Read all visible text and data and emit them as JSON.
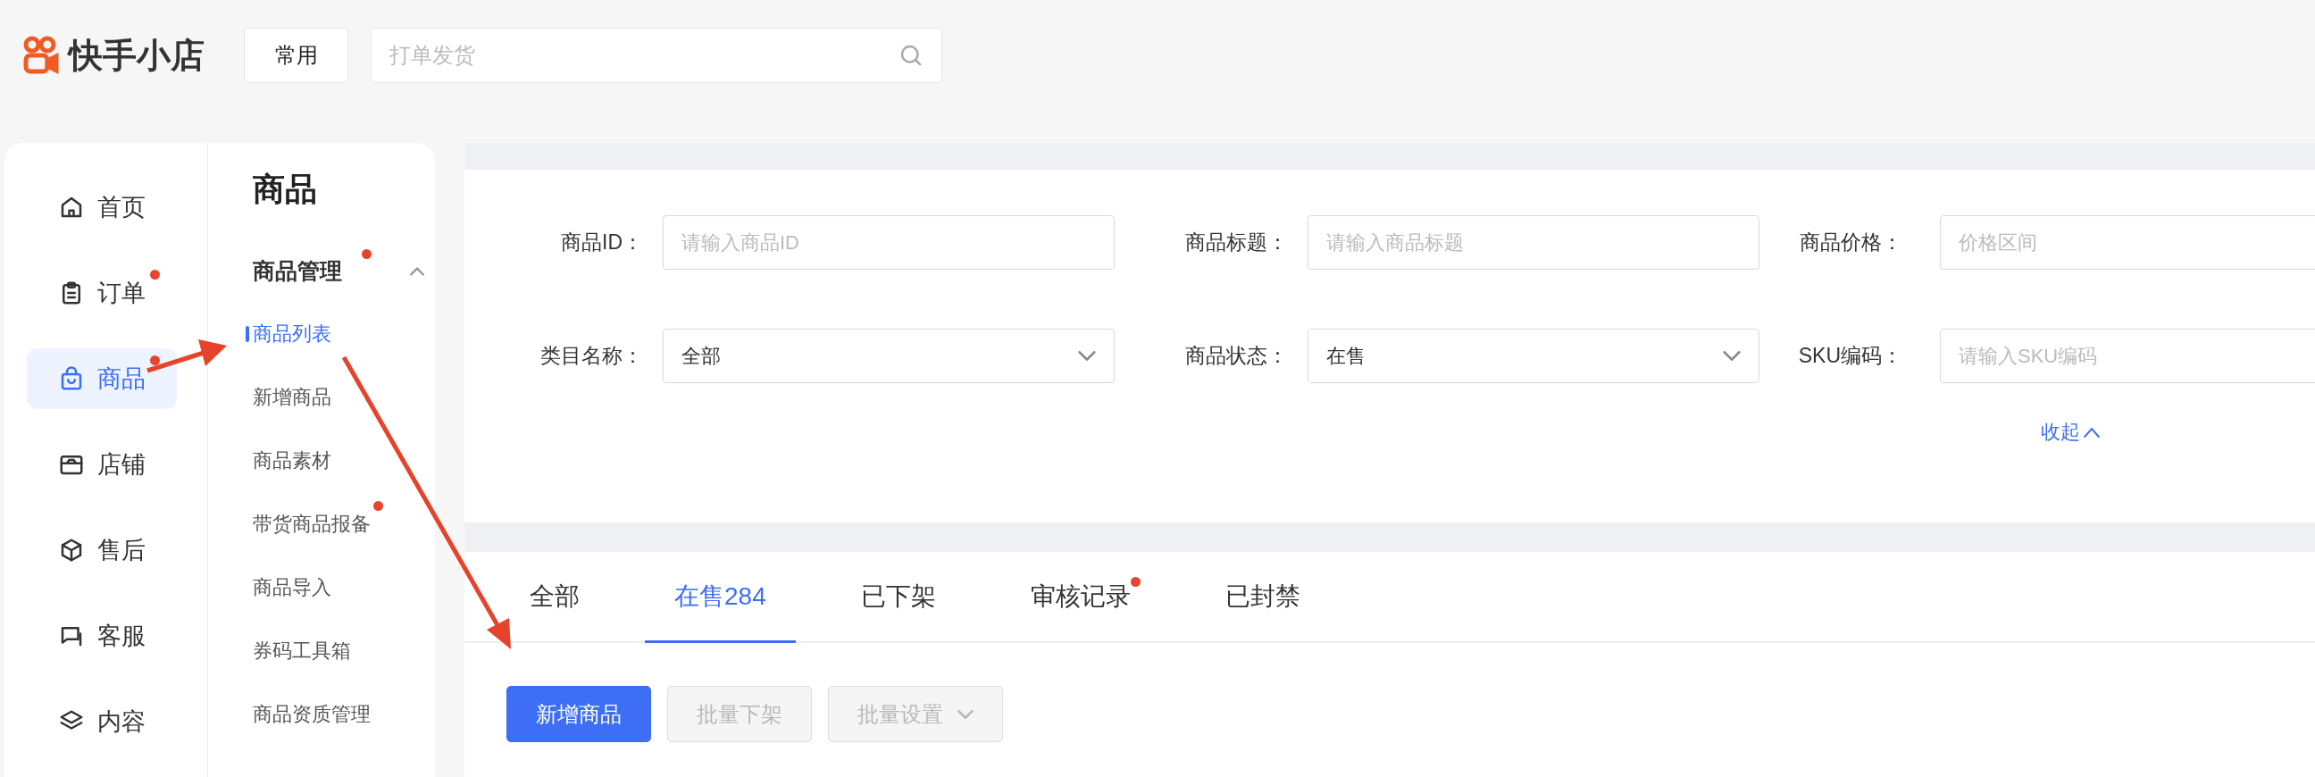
{
  "header": {
    "logo": "快手小店",
    "common_button": "常用",
    "search": {
      "placeholder": "打单发货"
    }
  },
  "nav": [
    {
      "label": "首页",
      "selected": false,
      "badge_dot": false
    },
    {
      "label": "订单",
      "selected": false,
      "badge_dot": true
    },
    {
      "label": "商品",
      "selected": true,
      "badge_dot": true
    },
    {
      "label": "店铺",
      "selected": false,
      "badge_dot": false
    },
    {
      "label": "售后",
      "selected": false,
      "badge_dot": false
    },
    {
      "label": "客服",
      "selected": false,
      "badge_dot": false
    },
    {
      "label": "内容",
      "selected": false,
      "badge_dot": false
    }
  ],
  "subnav": {
    "title": "商品",
    "group": {
      "label": "商品管理",
      "badge_dot": true,
      "expanded": true,
      "items": [
        {
          "label": "商品列表",
          "selected": true,
          "badge_dot": false
        },
        {
          "label": "新增商品",
          "selected": false,
          "badge_dot": false
        },
        {
          "label": "商品素材",
          "selected": false,
          "badge_dot": false
        },
        {
          "label": "带货商品报备",
          "selected": false,
          "badge_dot": true
        },
        {
          "label": "商品导入",
          "selected": false,
          "badge_dot": false
        },
        {
          "label": "券码工具箱",
          "selected": false,
          "badge_dot": false
        },
        {
          "label": "商品资质管理",
          "selected": false,
          "badge_dot": false
        }
      ]
    }
  },
  "filters": [
    {
      "label": "商品ID：",
      "kind": "input",
      "placeholder": "请输入商品ID"
    },
    {
      "label": "商品标题：",
      "kind": "input",
      "placeholder": "请输入商品标题"
    },
    {
      "label": "商品价格：",
      "kind": "input",
      "placeholder": "价格区间"
    },
    {
      "label": "类目名称：",
      "kind": "select",
      "value": "全部"
    },
    {
      "label": "商品状态：",
      "kind": "select",
      "value": "在售"
    },
    {
      "label": "SKU编码：",
      "kind": "input",
      "placeholder": "请输入SKU编码"
    }
  ],
  "collapse_link": "收起",
  "tabs": [
    {
      "label": "全部",
      "selected": false,
      "badge_dot": false
    },
    {
      "label": "在售284",
      "selected": true,
      "badge_dot": false
    },
    {
      "label": "已下架",
      "selected": false,
      "badge_dot": false
    },
    {
      "label": "审核记录",
      "selected": false,
      "badge_dot": true
    },
    {
      "label": "已封禁",
      "selected": false,
      "badge_dot": false
    }
  ],
  "buttons": [
    {
      "label": "新增商品",
      "kind": "primary",
      "disabled": false,
      "dropdown": false
    },
    {
      "label": "批量下架",
      "kind": "default",
      "disabled": true,
      "dropdown": false
    },
    {
      "label": "批量设置",
      "kind": "default",
      "disabled": true,
      "dropdown": true
    }
  ]
}
